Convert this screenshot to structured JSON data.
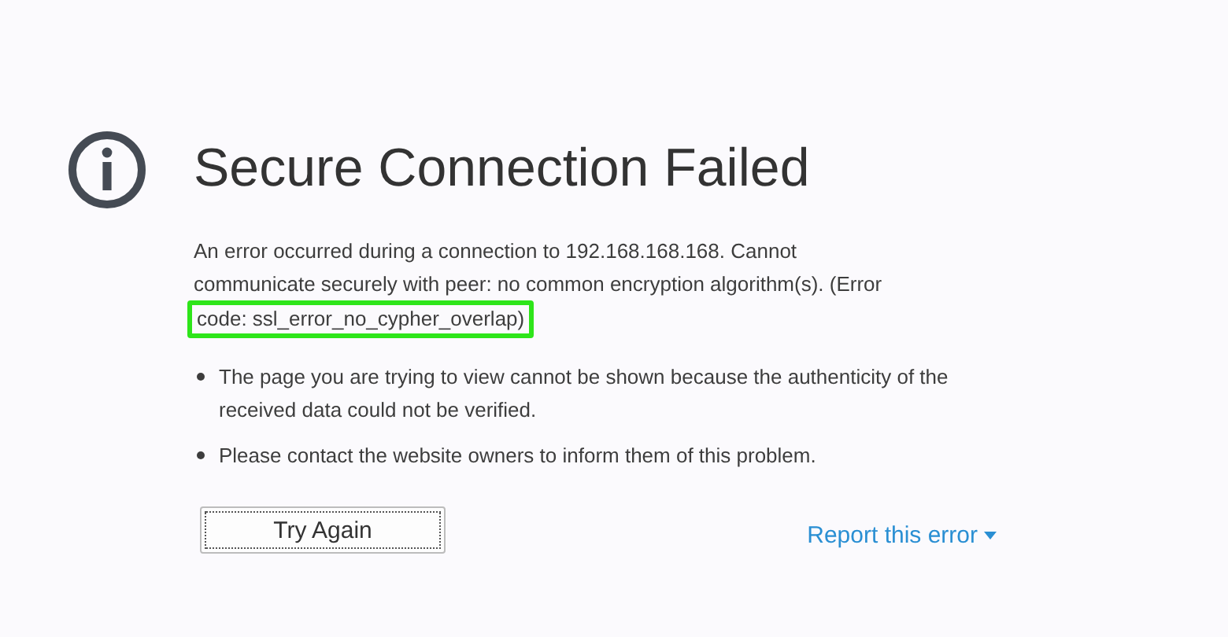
{
  "title": "Secure Connection Failed",
  "description": "An error occurred during a connection to 192.168.168.168. Cannot communicate securely with peer: no common encryption algorithm(s). (Error",
  "error_code": {
    "text": "code: ssl_error_no_cypher_overlap)",
    "highlighted": true
  },
  "bullets": [
    "The page you are trying to view cannot be shown because the authenticity of the received data could not be verified.",
    "Please contact the website owners to inform them of this problem."
  ],
  "try_again_button": "Try Again",
  "report_link": "Report this error"
}
